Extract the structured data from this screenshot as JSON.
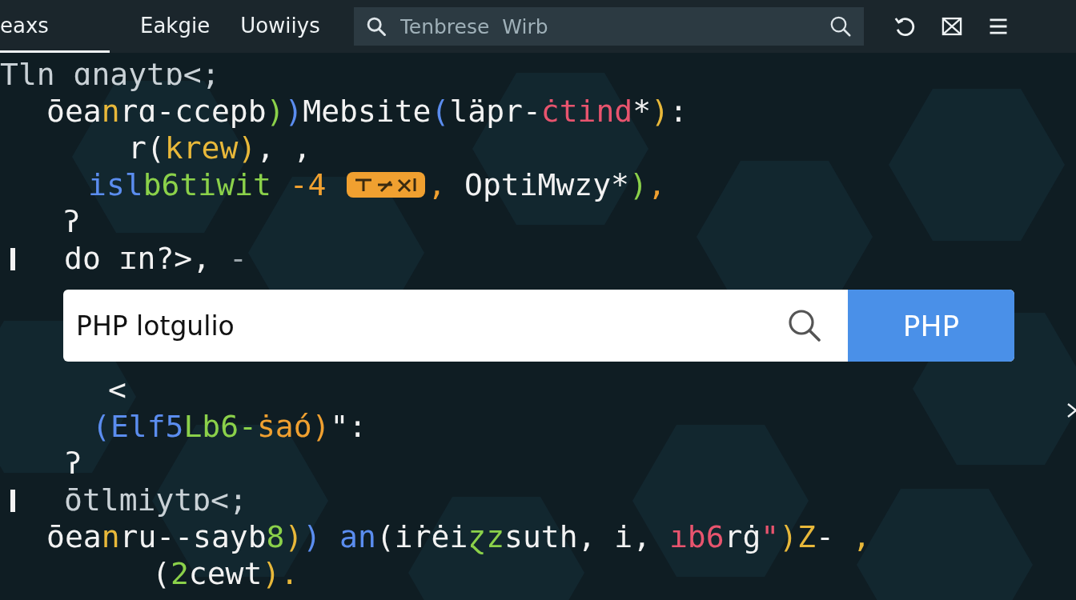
{
  "tabs": [
    {
      "label": "eaxs",
      "selected": true
    },
    {
      "label": "Eakgie",
      "selected": false
    },
    {
      "label": "Uowiiys",
      "selected": false
    }
  ],
  "top_search": {
    "placeholder": "Tenbrese  Wirb"
  },
  "code_top": [
    {
      "marked": false,
      "tokens": [
        {
          "text": "Tln",
          "color": "#c9d1d6"
        },
        {
          "text": " ɑnaytɒ<;",
          "color": "#c9d1d6"
        }
      ]
    },
    {
      "marked": false,
      "tokens": [
        {
          "text": "ōea",
          "color": "#f2f2f2"
        },
        {
          "text": "n",
          "color": "#e8b83a"
        },
        {
          "text": "rɑ-ccepb",
          "color": "#f2f2f2"
        },
        {
          "text": ")",
          "color": "#8bd14a"
        },
        {
          "text": ")",
          "color": "#5b8def"
        },
        {
          "text": "Mebsite",
          "color": "#f2f2f2"
        },
        {
          "text": "(",
          "color": "#5b8def"
        },
        {
          "text": "läpr-",
          "color": "#f2f2f2"
        },
        {
          "text": "ċtind",
          "color": "#e8546e"
        },
        {
          "text": "*",
          "color": "#f2f2f2"
        },
        {
          "text": ")",
          "color": "#e8b83a"
        },
        {
          "text": ":",
          "color": "#f2f2f2"
        }
      ]
    },
    {
      "marked": false,
      "tokens": [
        {
          "text": "r(",
          "color": "#f2f2f2"
        },
        {
          "text": "krew",
          "color": "#e8b83a"
        },
        {
          "text": ")",
          "color": "#e8b83a"
        },
        {
          "text": ", ,",
          "color": "#f2f2f2"
        }
      ]
    },
    {
      "marked": false,
      "highlight": true,
      "tokens": [
        {
          "text": "isl",
          "color": "#5b8def"
        },
        {
          "text": "b6tiwit",
          "color": "#8bd14a"
        },
        {
          "text": " -4 ",
          "color": "#f0a030"
        },
        {
          "text": ",",
          "color": "#f0a030"
        },
        {
          "text": " OptiMwzy",
          "color": "#f2f2f2"
        },
        {
          "text": "*",
          "color": "#f2f2f2"
        },
        {
          "text": ")",
          "color": "#8bd14a"
        },
        {
          "text": ",",
          "color": "#f0a030"
        }
      ]
    },
    {
      "marked": false,
      "tokens": [
        {
          "text": "ʔ",
          "color": "#f2f2f2"
        }
      ]
    },
    {
      "marked": true,
      "tokens": [
        {
          "text": "do ɪn?>,",
          "color": "#f2f2f2"
        },
        {
          "text": " -",
          "color": "#9aa4aa"
        }
      ]
    }
  ],
  "search": {
    "value": "PHP lotgulio",
    "button": "PHP"
  },
  "code_bottom": [
    {
      "marked": false,
      "tokens": [
        {
          "text": "<",
          "color": "#f2f2f2"
        }
      ]
    },
    {
      "marked": false,
      "tokens": [
        {
          "text": "(",
          "color": "#5b8def"
        },
        {
          "text": "Elf5",
          "color": "#5b8def"
        },
        {
          "text": "Lb6-",
          "color": "#8bd14a"
        },
        {
          "text": "ṡaó",
          "color": "#f0a030"
        },
        {
          "text": ")",
          "color": "#f0a030"
        },
        {
          "text": "\":",
          "color": "#f2f2f2"
        }
      ]
    },
    {
      "marked": false,
      "tokens": [
        {
          "text": "ʔ",
          "color": "#f2f2f2"
        }
      ]
    },
    {
      "marked": true,
      "tokens": [
        {
          "text": "ōtlmiytɒ<;",
          "color": "#c9d1d6"
        }
      ]
    },
    {
      "marked": false,
      "tokens": [
        {
          "text": "ōea",
          "color": "#f2f2f2"
        },
        {
          "text": "n",
          "color": "#e8b83a"
        },
        {
          "text": "ru--sayb",
          "color": "#f2f2f2"
        },
        {
          "text": "8",
          "color": "#8bd14a"
        },
        {
          "text": ")",
          "color": "#e8b83a"
        },
        {
          "text": ")",
          "color": "#5b8def"
        },
        {
          "text": " an",
          "color": "#5b8def"
        },
        {
          "text": "(iṙėi",
          "color": "#f2f2f2"
        },
        {
          "text": "ɀz",
          "color": "#8bd14a"
        },
        {
          "text": "suth, i, ",
          "color": "#f2f2f2"
        },
        {
          "text": "ıb6",
          "color": "#e8546e"
        },
        {
          "text": "rġ",
          "color": "#f2f2f2"
        },
        {
          "text": "\"",
          "color": "#e8546e"
        },
        {
          "text": ")Z",
          "color": "#e8b83a"
        },
        {
          "text": "-",
          "color": "#f2f2f2"
        },
        {
          "text": " ,",
          "color": "#e8b83a"
        }
      ]
    },
    {
      "marked": false,
      "tokens": [
        {
          "text": "(",
          "color": "#f2f2f2"
        },
        {
          "text": "2",
          "color": "#8bd14a"
        },
        {
          "text": "cewt",
          "color": "#f2f2f2"
        },
        {
          "text": ")",
          "color": "#e8b83a"
        },
        {
          "text": ".",
          "color": "#e8b83a"
        }
      ]
    }
  ]
}
